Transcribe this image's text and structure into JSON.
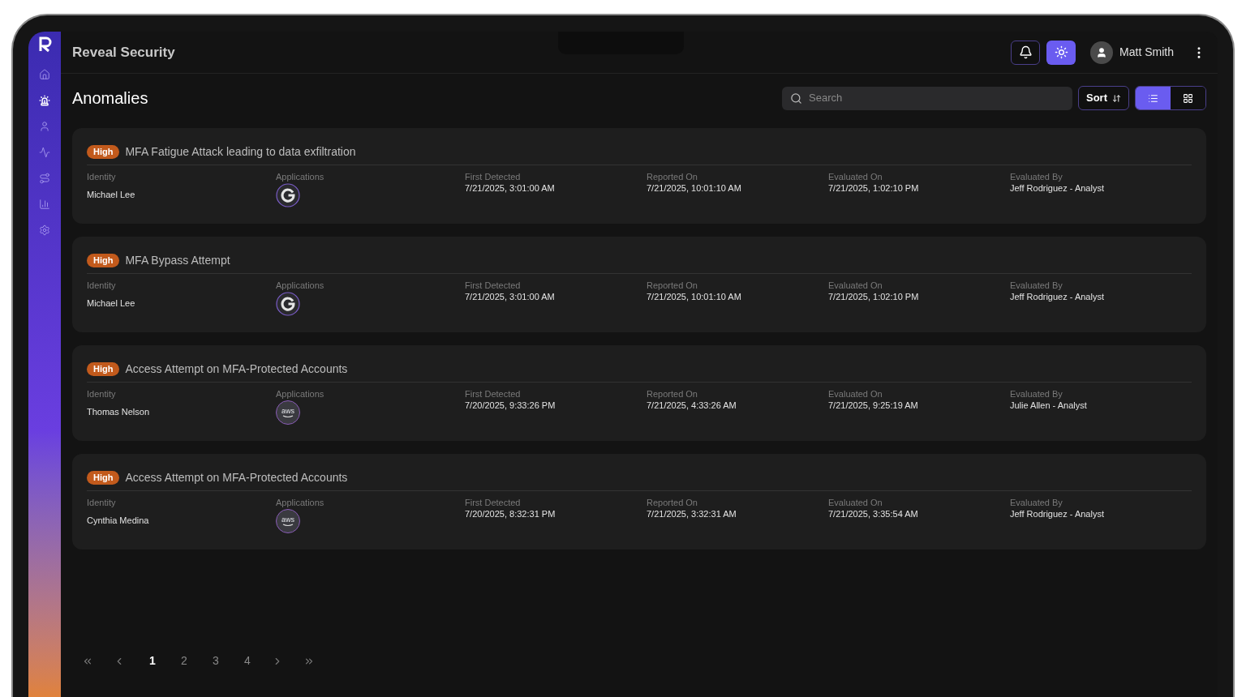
{
  "app": {
    "name": "Reveal Security"
  },
  "sidebar": {
    "items": [
      {
        "selected": false
      },
      {
        "selected": true
      },
      {
        "selected": false
      },
      {
        "selected": false
      },
      {
        "selected": false
      },
      {
        "selected": false
      },
      {
        "selected": false
      }
    ]
  },
  "header": {
    "notifications": {
      "selected": false
    },
    "theme": {
      "selected": true
    },
    "user": {
      "name": "Matt Smith"
    }
  },
  "page": {
    "title": "Anomalies",
    "search": {
      "placeholder": "Search"
    },
    "sort": {
      "label": "Sort"
    },
    "view_toggle": [
      {
        "selected": true
      },
      {
        "selected": false
      }
    ]
  },
  "anomalies": [
    {
      "severity": "High",
      "title": "MFA Fatigue Attack leading to data exfiltration",
      "fields": [
        {
          "label": "Identity",
          "value": "Michael Lee"
        },
        {
          "label": "Applications",
          "app": {
            "kind": "google"
          }
        },
        {
          "label": "First Detected",
          "value": "7/21/2025, 3:01:00 AM"
        },
        {
          "label": "Reported On",
          "value": "7/21/2025, 10:01:10 AM"
        },
        {
          "label": "Evaluated On",
          "value": "7/21/2025, 1:02:10 PM"
        },
        {
          "label": "Evaluated By",
          "value": "Jeff Rodriguez - Analyst"
        }
      ]
    },
    {
      "severity": "High",
      "title": "MFA Bypass Attempt",
      "fields": [
        {
          "label": "Identity",
          "value": "Michael Lee"
        },
        {
          "label": "Applications",
          "app": {
            "kind": "google"
          }
        },
        {
          "label": "First Detected",
          "value": "7/21/2025, 3:01:00 AM"
        },
        {
          "label": "Reported On",
          "value": "7/21/2025, 10:01:10 AM"
        },
        {
          "label": "Evaluated On",
          "value": "7/21/2025, 1:02:10 PM"
        },
        {
          "label": "Evaluated By",
          "value": "Jeff Rodriguez - Analyst"
        }
      ]
    },
    {
      "severity": "High",
      "title": "Access Attempt on MFA-Protected Accounts",
      "fields": [
        {
          "label": "Identity",
          "value": "Thomas Nelson"
        },
        {
          "label": "Applications",
          "app": {
            "kind": "aws",
            "label": "aws"
          }
        },
        {
          "label": "First Detected",
          "value": "7/20/2025, 9:33:26 PM"
        },
        {
          "label": "Reported On",
          "value": "7/21/2025, 4:33:26 AM"
        },
        {
          "label": "Evaluated On",
          "value": "7/21/2025, 9:25:19 AM"
        },
        {
          "label": "Evaluated By",
          "value": "Julie Allen - Analyst"
        }
      ]
    },
    {
      "severity": "High",
      "title": "Access Attempt on MFA-Protected Accounts",
      "fields": [
        {
          "label": "Identity",
          "value": "Cynthia Medina"
        },
        {
          "label": "Applications",
          "app": {
            "kind": "aws",
            "label": "aws"
          }
        },
        {
          "label": "First Detected",
          "value": "7/20/2025, 8:32:31 PM"
        },
        {
          "label": "Reported On",
          "value": "7/21/2025, 3:32:31 AM"
        },
        {
          "label": "Evaluated On",
          "value": "7/21/2025, 3:35:54 AM"
        },
        {
          "label": "Evaluated By",
          "value": "Jeff Rodriguez - Analyst"
        }
      ]
    }
  ],
  "pagination": {
    "pages": [
      {
        "label": "1",
        "selected": true
      },
      {
        "label": "2",
        "selected": false
      },
      {
        "label": "3",
        "selected": false
      },
      {
        "label": "4",
        "selected": false
      }
    ]
  }
}
